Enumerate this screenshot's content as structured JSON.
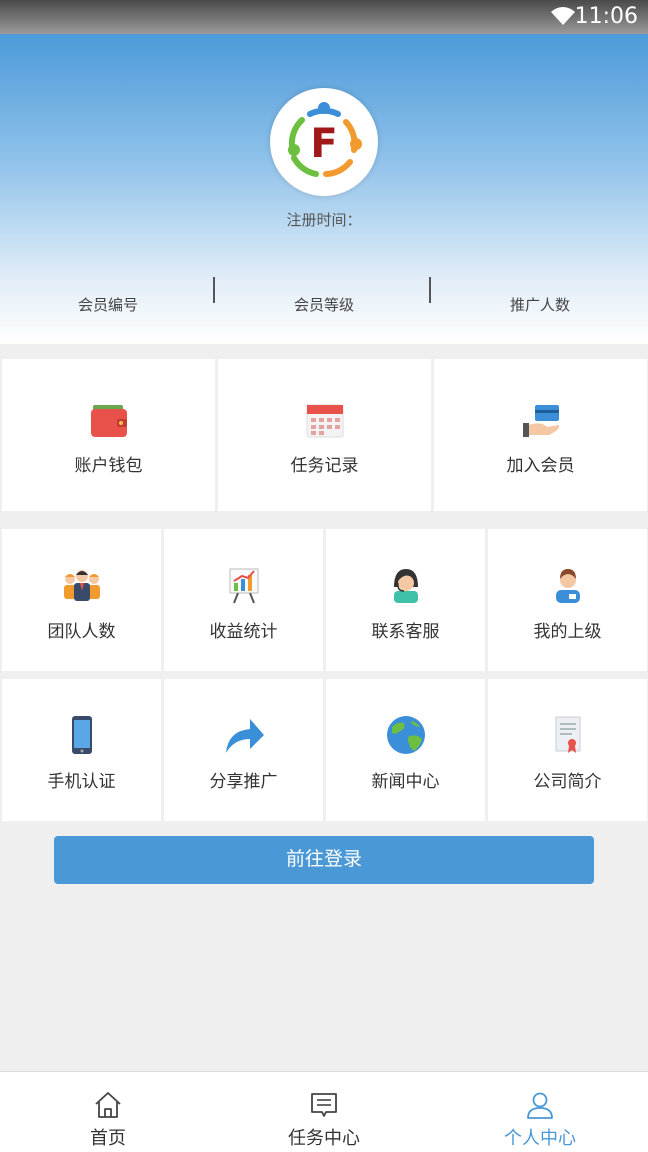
{
  "status_bar": {
    "time": "11:06",
    "wifi_icon": "wifi-icon"
  },
  "profile": {
    "logo_letter": "F",
    "register_time_label": "注册时间：",
    "stats": [
      {
        "label": "会员编号"
      },
      {
        "label": "会员等级"
      },
      {
        "label": "推广人数"
      }
    ]
  },
  "menu_top": [
    {
      "label": "账户钱包",
      "icon": "wallet-icon"
    },
    {
      "label": "任务记录",
      "icon": "calendar-icon"
    },
    {
      "label": "加入会员",
      "icon": "card-hand-icon"
    }
  ],
  "menu_row1": [
    {
      "label": "团队人数",
      "icon": "team-icon"
    },
    {
      "label": "收益统计",
      "icon": "chart-board-icon"
    },
    {
      "label": "联系客服",
      "icon": "support-agent-icon"
    },
    {
      "label": "我的上级",
      "icon": "superior-user-icon"
    }
  ],
  "menu_row2": [
    {
      "label": "手机认证",
      "icon": "phone-icon"
    },
    {
      "label": "分享推广",
      "icon": "share-arrow-icon"
    },
    {
      "label": "新闻中心",
      "icon": "globe-icon"
    },
    {
      "label": "公司简介",
      "icon": "certificate-icon"
    }
  ],
  "login_button": "前往登录",
  "tabbar": [
    {
      "label": "首页",
      "icon": "home-icon"
    },
    {
      "label": "任务中心",
      "icon": "message-icon"
    },
    {
      "label": "个人中心",
      "icon": "user-icon",
      "active": true
    }
  ],
  "colors": {
    "accent": "#4a98d6",
    "header_top": "#4c9ad9"
  }
}
